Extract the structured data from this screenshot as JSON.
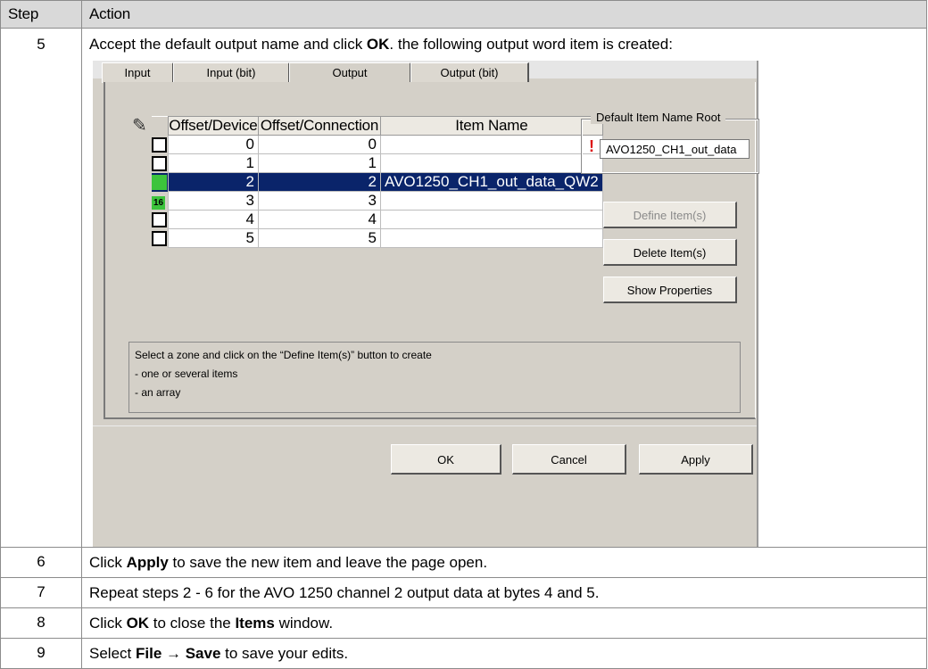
{
  "table": {
    "header_step": "Step",
    "header_action": "Action"
  },
  "rows": [
    {
      "step": "5",
      "pre": "Accept the default output name and click ",
      "bold": "OK",
      "post": ". the following output word item is created:"
    },
    {
      "step": "6",
      "pre": "Click ",
      "bold": "Apply",
      "post": " to save the new item and leave the page open."
    },
    {
      "step": "7",
      "text": "Repeat steps 2 - 6 for the AVO 1250 channel 2 output data at bytes 4 and 5."
    },
    {
      "step": "8",
      "pre": "Click ",
      "bold": "OK",
      "mid": " to close the ",
      "bold2": "Items",
      "post": " window."
    },
    {
      "step": "9",
      "pre": "Select ",
      "bold": "File → Save",
      "post": " to save your edits."
    }
  ],
  "dialog": {
    "tabs": [
      "Input",
      "Input (bit)",
      "Output",
      "Output (bit)"
    ],
    "active_tab": "Output",
    "grid": {
      "columns": [
        "Offset/Device",
        "Offset/Connection",
        "Item Name"
      ],
      "rows": [
        {
          "device": "0",
          "connection": "0",
          "name": "",
          "mark": "empty"
        },
        {
          "device": "1",
          "connection": "1",
          "name": "",
          "mark": "empty"
        },
        {
          "device": "2",
          "connection": "2",
          "name": "AVO1250_CH1_out_data_QW2",
          "mark": "green",
          "selected": true
        },
        {
          "device": "3",
          "connection": "3",
          "name": "",
          "mark": "16"
        },
        {
          "device": "4",
          "connection": "4",
          "name": "",
          "mark": "empty"
        },
        {
          "device": "5",
          "connection": "5",
          "name": "",
          "mark": "empty"
        }
      ]
    },
    "default_name_title": "Default Item Name Root",
    "default_name_value": "AVO1250_CH1_out_data",
    "warning_glyph": "!",
    "buttons": {
      "define": "Define Item(s)",
      "delete": "Delete Item(s)",
      "show": "Show Properties",
      "ok": "OK",
      "cancel": "Cancel",
      "apply": "Apply"
    },
    "hint": {
      "line1": "Select a zone and click on the “Define Item(s)” button to create",
      "line2": "- one or several items",
      "line3": "- an array"
    },
    "colors": {
      "selected_row": "#0a246a",
      "green_mark": "#3cc43c",
      "warning": "#dd1111"
    }
  }
}
